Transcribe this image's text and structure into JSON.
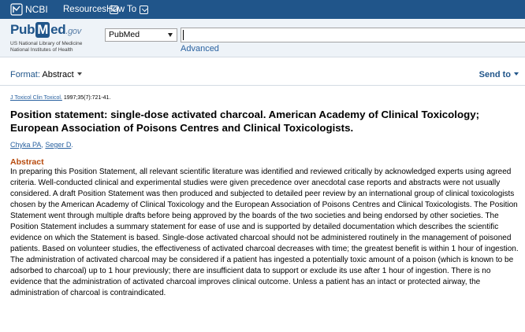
{
  "header": {
    "brand": "NCBI",
    "nav": [
      {
        "label": "Resources"
      },
      {
        "label": "How To"
      }
    ]
  },
  "logo": {
    "pub": "Pub",
    "m": "M",
    "ed": "ed",
    "gov": ".gov",
    "line1": "US National Library of Medicine",
    "line2": "National Institutes of Health"
  },
  "search": {
    "database": "PubMed",
    "query": "",
    "advanced_label": "Advanced"
  },
  "toolbar": {
    "format_label": "Format:",
    "format_value": "Abstract",
    "send_to_label": "Send to"
  },
  "article": {
    "journal": "J Toxicol Clin Toxicol.",
    "citation_rest": " 1997;35(7):721-41.",
    "title": "Position statement: single-dose activated charcoal. American Academy of Clinical Toxicology; European Association of Poisons Centres and Clinical Toxicologists.",
    "authors": [
      {
        "name": "Chyka PA"
      },
      {
        "name": "Seger D"
      }
    ],
    "author_sep": ", ",
    "author_end": ".",
    "abstract_heading": "Abstract",
    "abstract_text": "In preparing this Position Statement, all relevant scientific literature was identified and reviewed critically by acknowledged experts using agreed criteria. Well-conducted clinical and experimental studies were given precedence over anecdotal case reports and abstracts were not usually considered. A draft Position Statement was then produced and subjected to detailed peer review by an international group of clinical toxicologists chosen by the American Academy of Clinical Toxicology and the European Association of Poisons Centres and Clinical Toxicologists. The Position Statement went through multiple drafts before being approved by the boards of the two societies and being endorsed by other societies. The Position Statement includes a summary statement for ease of use and is supported by detailed documentation which describes the scientific evidence on which the Statement is based. Single-dose activated charcoal should not be administered routinely in the management of poisoned patients. Based on volunteer studies, the effectiveness of activated charcoal decreases with time; the greatest benefit is within 1 hour of ingestion. The administration of activated charcoal may be considered if a patient has ingested a potentially toxic amount of a poison (which is known to be adsorbed to charcoal) up to 1 hour previously; there are insufficient data to support or exclude its use after 1 hour of ingestion. There is no evidence that the administration of activated charcoal improves clinical outcome. Unless a patient has an intact or protected airway, the administration of charcoal is contraindicated."
  }
}
